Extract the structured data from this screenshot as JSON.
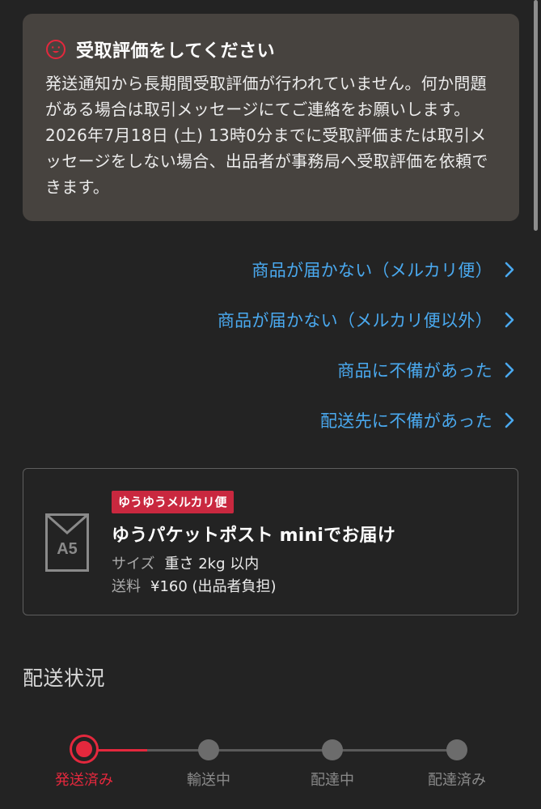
{
  "notice": {
    "title": "受取評価をしてください",
    "icon": "face-icon",
    "body": "発送通知から長期間受取評価が行われていません。何か問題がある場合は取引メッセージにてご連絡をお願いします。2026年7月18日 (土) 13時0分までに受取評価または取引メッセージをしない場合、出品者が事務局へ受取評価を依頼できます。",
    "bg_color": "#47433f",
    "icon_color": "#e4283d"
  },
  "links": [
    {
      "label": "商品が届かない（メルカリ便）"
    },
    {
      "label": "商品が届かない（メルカリ便以外）"
    },
    {
      "label": "商品に不備があった"
    },
    {
      "label": "配送先に不備があった"
    }
  ],
  "link_color": "#4aa9ef",
  "shipping": {
    "badge": "ゆうゆうメルカリ便",
    "envelope_label": "A5",
    "method": "ゆうパケットポスト miniでお届け",
    "size_key": "サイズ",
    "size_value": "重さ 2kg 以内",
    "fee_key": "送料",
    "fee_value": "¥160 (出品者負担)",
    "badge_color": "#c9283f"
  },
  "status": {
    "title": "配送状況",
    "steps": [
      {
        "label": "発送済み",
        "active": true
      },
      {
        "label": "輸送中",
        "active": false
      },
      {
        "label": "配達中",
        "active": false
      },
      {
        "label": "配達済み",
        "active": false
      }
    ],
    "active_color": "#e4283d",
    "inactive_color": "#6c6c6c"
  }
}
